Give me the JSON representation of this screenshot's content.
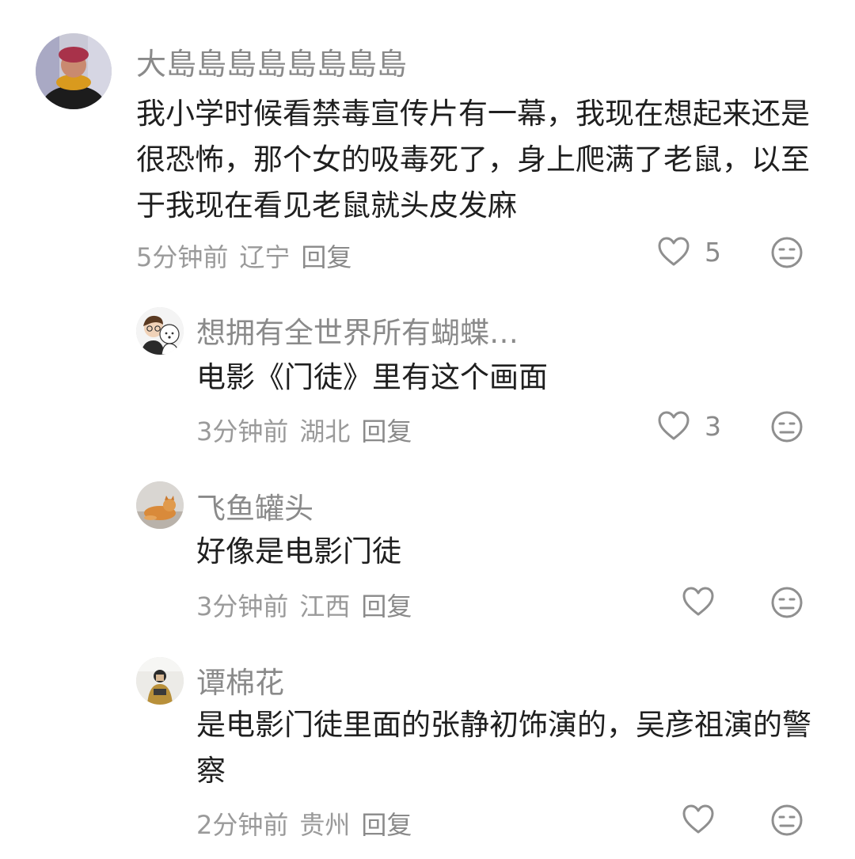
{
  "comments": [
    {
      "username": "大島島島島島島島島",
      "text": "我小学时候看禁毒宣传片有一幕，我现在想起来还是很恐怖，那个女的吸毒死了，身上爬满了老鼠，以至于我现在看见老鼠就头皮发麻",
      "time": "5分钟前",
      "location": "辽宁",
      "reply_label": "回复",
      "likes": "5"
    },
    {
      "username": "想拥有全世界所有蝴蝶…",
      "text": "电影《门徒》里有这个画面",
      "time": "3分钟前",
      "location": "湖北",
      "reply_label": "回复",
      "likes": "3"
    },
    {
      "username": "飞鱼罐头",
      "text": "好像是电影门徒",
      "time": "3分钟前",
      "location": "江西",
      "reply_label": "回复",
      "likes": ""
    },
    {
      "username": "谭棉花",
      "text": "是电影门徒里面的张静初饰演的，吴彦祖演的警察",
      "time": "2分钟前",
      "location": "贵州",
      "reply_label": "回复",
      "likes": ""
    }
  ],
  "icons": {
    "like": "heart-outline-icon",
    "dislike": "meh-face-icon"
  },
  "colors": {
    "text": "#1f1f1f",
    "muted": "#8a8a8a",
    "icon": "#9a9a9a"
  }
}
